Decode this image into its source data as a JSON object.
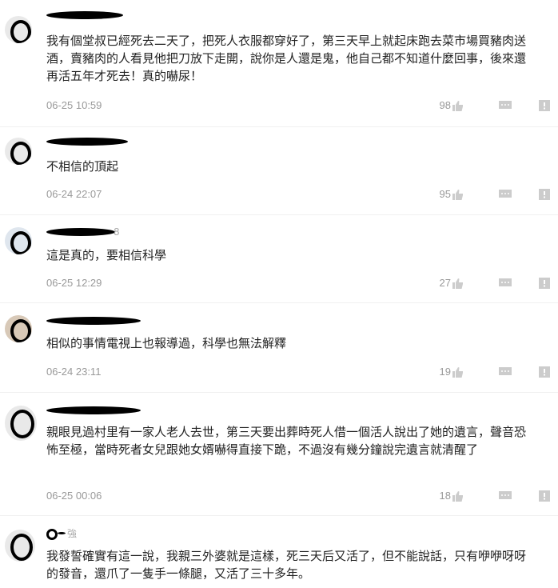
{
  "comments": [
    {
      "name_tail": "",
      "text": "我有個堂叔已經死去二天了，把死人衣服都穿好了，第三天早上就起床跑去菜市場買豬肉送酒，賣豬肉的人看見他把刀放下走開，說你是人還是鬼，他自己都不知道什麼回事，後來還再活五年才死去！真的嚇尿！",
      "time": "06-25 10:59",
      "likes": "98"
    },
    {
      "name_tail": "",
      "text": "不相信的頂起",
      "time": "06-24 22:07",
      "likes": "95"
    },
    {
      "name_tail": "8",
      "text": "這是真的，要相信科學",
      "time": "06-25 12:29",
      "likes": "27"
    },
    {
      "name_tail": "",
      "text": "相似的事情電視上也報導過，科學也無法解釋",
      "time": "06-24 23:11",
      "likes": "19"
    },
    {
      "name_tail": "",
      "text": "親眼見過村里有一家人老人去世，第三天要出葬時死人借一個活人說出了她的遺言，聲音恐怖至極，當時死者女兒跟她女婿嚇得直接下跪，不過沒有幾分鐘說完遺言就清醒了",
      "time": "06-25 00:06",
      "likes": "18"
    },
    {
      "name_tail": "強",
      "text": "我發誓確實有這一說，我親三外婆就是這樣，死三天后又活了，但不能說話，只有咿咿呀呀的發音，還爪了一隻手一條腿，又活了三十多年。",
      "time": "",
      "likes": ""
    }
  ]
}
